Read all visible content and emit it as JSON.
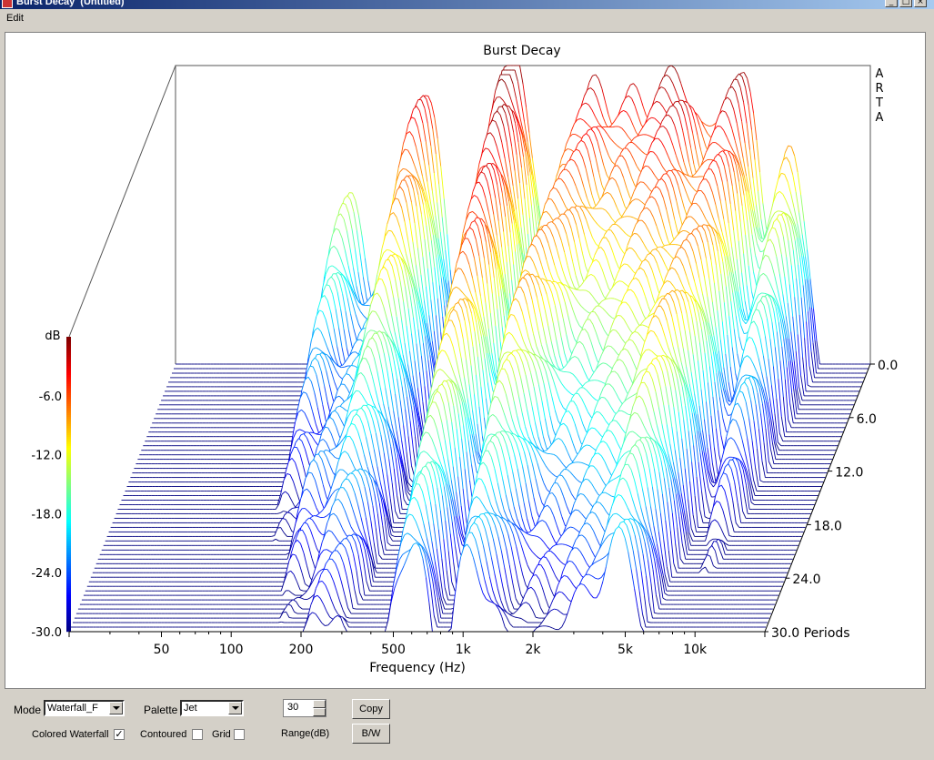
{
  "window": {
    "title": "Burst Decay  (Untitled)"
  },
  "menu": {
    "edit": "Edit"
  },
  "chart_data": {
    "type": "waterfall",
    "title": "Burst Decay",
    "watermark": "ARTA",
    "xlabel": "Frequency (Hz)",
    "x_scale": "log",
    "x_ticks": [
      "50",
      "100",
      "200",
      "500",
      "1k",
      "2k",
      "5k",
      "10k"
    ],
    "x_tick_values": [
      50,
      100,
      200,
      500,
      1000,
      2000,
      5000,
      10000
    ],
    "xlim": [
      20,
      20000
    ],
    "z_label": "dB",
    "z_ticks": [
      "-6.0",
      "-12.0",
      "-18.0",
      "-24.0",
      "-30.0"
    ],
    "zlim": [
      -30,
      0
    ],
    "depth_ticks": [
      "0.0",
      "6.0",
      "12.0",
      "18.0",
      "24.0",
      "30.0 Periods"
    ],
    "depth_range": [
      0,
      30
    ],
    "depth_unit": "Periods",
    "num_slices": 60,
    "palette": "Jet",
    "peaks": [
      {
        "freq": 230,
        "level": -1.5,
        "period": 0
      },
      {
        "freq": 540,
        "level": -0.5,
        "period": 0
      },
      {
        "freq": 1350,
        "level": -1.5,
        "period": 0
      },
      {
        "freq": 1900,
        "level": -2.5,
        "period": 0
      },
      {
        "freq": 2600,
        "level": -2.0,
        "period": 0
      },
      {
        "freq": 5500,
        "level": -0.5,
        "period": 0
      },
      {
        "freq": 3300,
        "level": -3.0,
        "period": 3
      },
      {
        "freq": 110,
        "level": -12.0,
        "period": 0
      },
      {
        "freq": 9000,
        "level": -8.0,
        "period": 0
      },
      {
        "freq": 620,
        "level": -6.0,
        "period": 12
      },
      {
        "freq": 1050,
        "level": -8.0,
        "period": 15
      },
      {
        "freq": 4500,
        "level": -10.0,
        "period": 18
      },
      {
        "freq": 160,
        "level": -22.0,
        "period": 20
      },
      {
        "freq": 290,
        "level": -24.0,
        "period": 24
      }
    ]
  },
  "controls": {
    "mode_label": "Mode",
    "mode_value": "Waterfall_F",
    "palette_label": "Palette",
    "palette_value": "Jet",
    "range_value": "30",
    "range_label": "Range(dB)",
    "copy_label": "Copy",
    "bw_label": "B/W",
    "colored_waterfall_label": "Colored Waterfall",
    "colored_waterfall_checked": "✓",
    "contoured_label": "Contoured",
    "grid_label": "Grid"
  }
}
